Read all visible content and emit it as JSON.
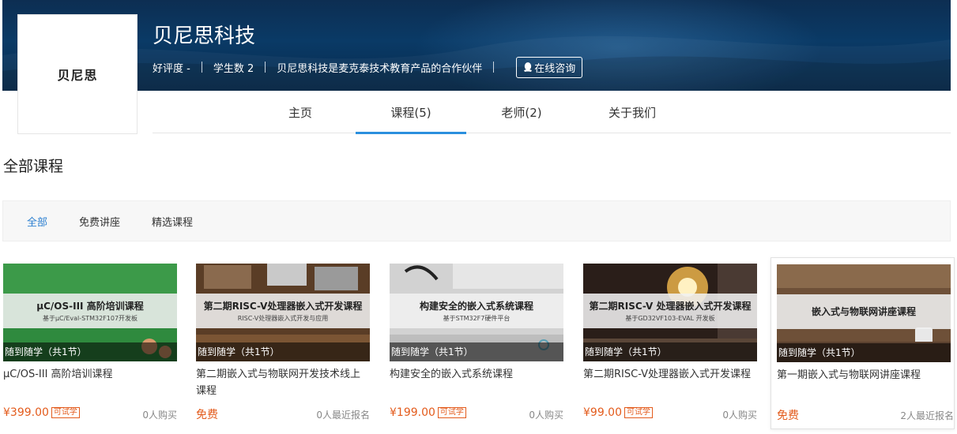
{
  "org": {
    "logo_text": "贝尼思",
    "name": "贝尼思科技",
    "rating": "好评度 -",
    "students": "学生数 2",
    "description": "贝尼思科技是麦克泰技术教育产品的合作伙伴",
    "consult_label": "在线咨询"
  },
  "tabs": [
    {
      "label": "主页"
    },
    {
      "label": "课程(5)"
    },
    {
      "label": "老师(2)"
    },
    {
      "label": "关于我们"
    }
  ],
  "section_title": "全部课程",
  "filters": [
    {
      "label": "全部"
    },
    {
      "label": "免费讲座"
    },
    {
      "label": "精选课程"
    }
  ],
  "courses": [
    {
      "thumb_title": "μC/OS-III 高阶培训课程",
      "thumb_sub": "基于μC/Eval-STM32F107开发板",
      "badge": "随到随学（共1节）",
      "title": "μC/OS-III 高阶培训课程",
      "price": "¥399.00",
      "trial": "可试学",
      "buyers": "0人购买",
      "bg": "#2f8a3e"
    },
    {
      "thumb_title": "第二期RISC-V处理器嵌入式开发课程",
      "thumb_sub": "RISC-V处理器嵌入式开发与应用",
      "badge": "随到随学（共1节）",
      "title": "第二期嵌入式与物联网开发技术线上课程",
      "price": "免费",
      "trial": "",
      "buyers": "0人最近报名",
      "bg": "#6b4a2e"
    },
    {
      "thumb_title": "构建安全的嵌入式系统课程",
      "thumb_sub": "基于STM32F7硬件平台",
      "badge": "随到随学（共1节）",
      "title": "构建安全的嵌入式系统课程",
      "price": "¥199.00",
      "trial": "可试学",
      "buyers": "0人购买",
      "bg": "#cfcfcf"
    },
    {
      "thumb_title": "第二期RISC-V 处理器嵌入式开发课程",
      "thumb_sub": "基于GD32VF103-EVAL 开发板",
      "badge": "随到随学（共1节）",
      "title": "第二期RISC-V处理器嵌入式开发课程",
      "price": "¥99.00",
      "trial": "可试学",
      "buyers": "0人购买",
      "bg": "#3a2a22"
    },
    {
      "thumb_title": "嵌入式与物联网讲座课程",
      "thumb_sub": "",
      "badge": "随到随学（共1节）",
      "title": "第一期嵌入式与物联网讲座课程",
      "price": "免费",
      "trial": "",
      "buyers": "2人最近报名",
      "bg": "#7a5a3c"
    }
  ]
}
